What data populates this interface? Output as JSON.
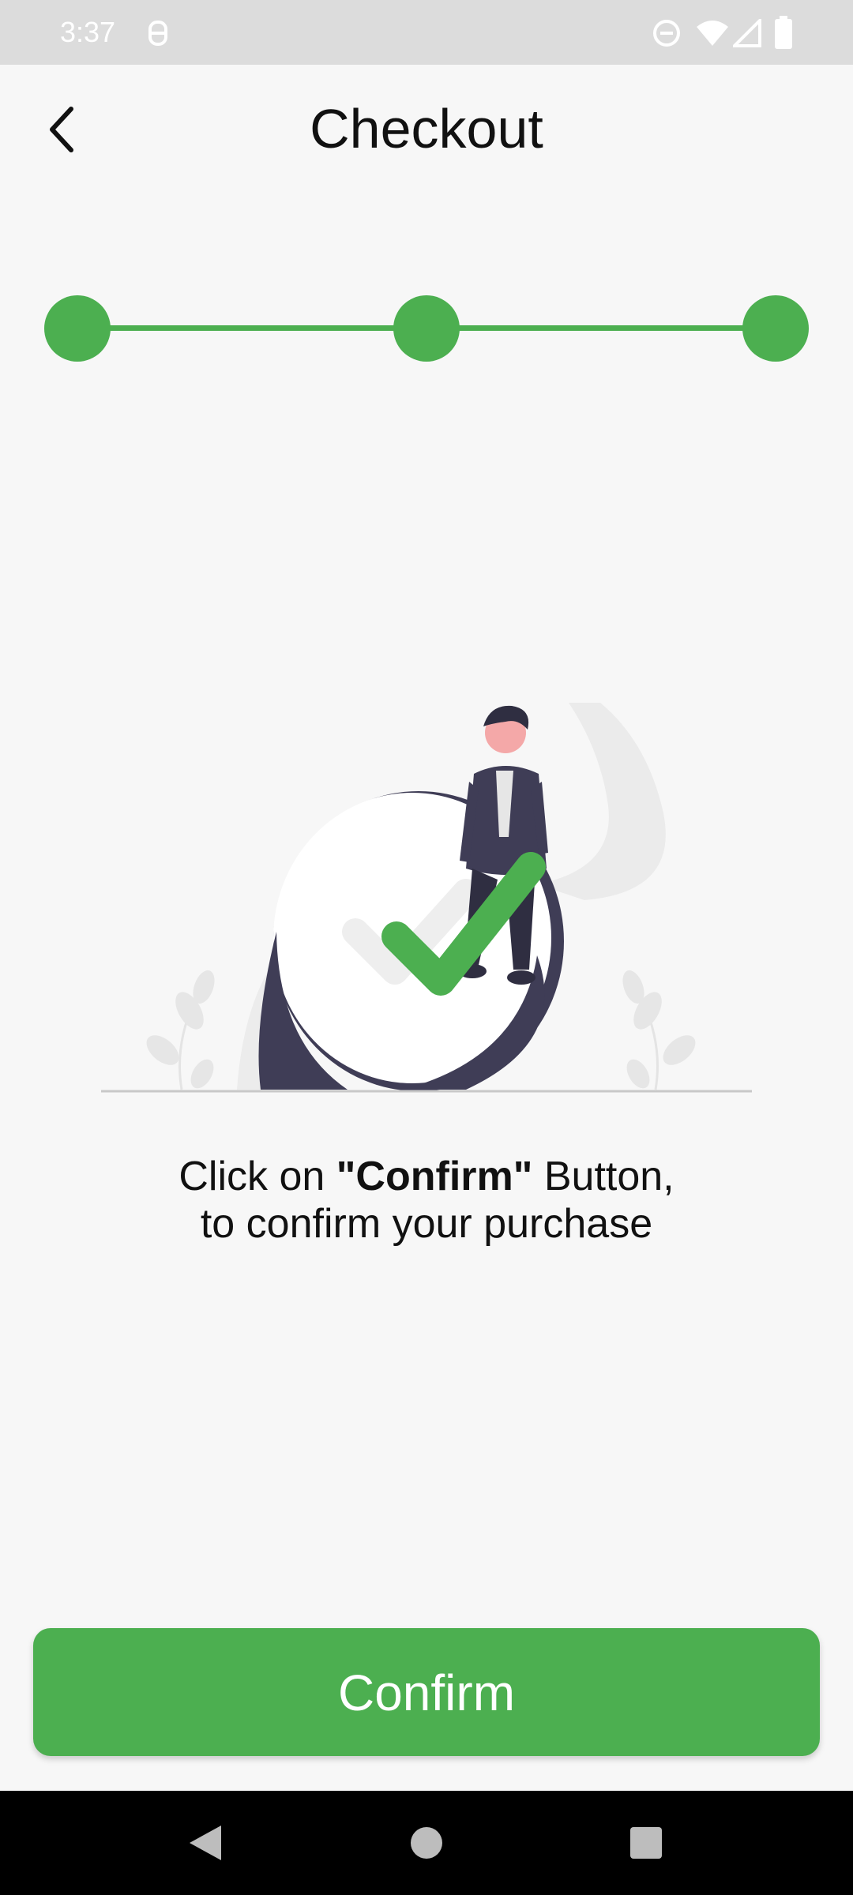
{
  "status_bar": {
    "time": "3:37",
    "icons": [
      "notification-icon",
      "do-not-disturb-icon",
      "wifi-icon",
      "signal-icon",
      "battery-icon"
    ]
  },
  "header": {
    "title": "Checkout",
    "back_icon": "chevron-left-icon"
  },
  "stepper": {
    "steps": 3,
    "completed": 3,
    "color": "#4caf50"
  },
  "message": {
    "line1_prefix": "Click on ",
    "line1_bold": "\"Confirm\"",
    "line1_suffix": " Button,",
    "line2": "to confirm your purchase"
  },
  "confirm_button": {
    "label": "Confirm",
    "color": "#4caf50"
  },
  "nav_bar": {
    "buttons": [
      "back-triangle-icon",
      "home-circle-icon",
      "recents-square-icon"
    ]
  }
}
